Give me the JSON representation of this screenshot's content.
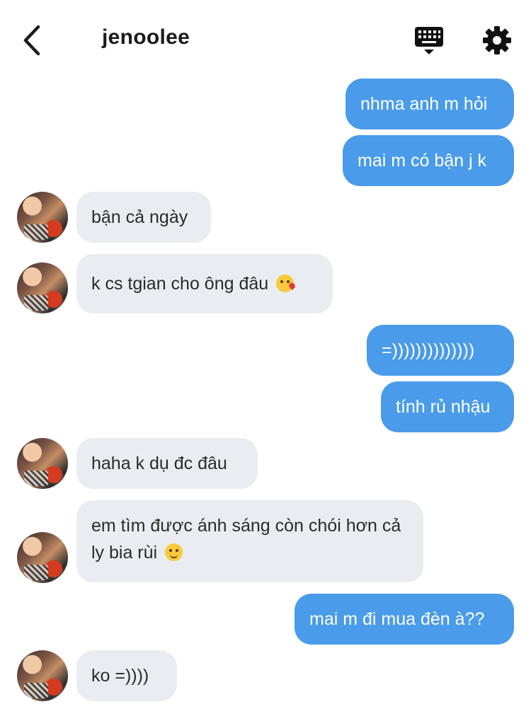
{
  "header": {
    "title": "jenoolee",
    "back_icon": "chevron-left-icon",
    "keyboard_icon": "keyboard-icon",
    "settings_icon": "gear-icon"
  },
  "colors": {
    "sent_bubble": "#4a9bea",
    "received_bubble": "#e9ecf1"
  },
  "messages": [
    {
      "from": "me",
      "text": "nhma anh m hỏi"
    },
    {
      "from": "me",
      "text": "mai m có bận j k"
    },
    {
      "from": "them",
      "text": "bận cả ngày"
    },
    {
      "from": "them",
      "text": "k cs tgian cho ông đâu",
      "emoji": "kissing-face-emoji"
    },
    {
      "from": "me",
      "text": "=))))))))))))))"
    },
    {
      "from": "me",
      "text": "tính rủ nhậu"
    },
    {
      "from": "them",
      "text": "haha k dụ đc đâu"
    },
    {
      "from": "them",
      "text": "em tìm được ánh sáng còn chói hơn cả ly bia rùi",
      "emoji": "smiling-face-emoji"
    },
    {
      "from": "me",
      "text": "mai m đi mua đèn à??"
    },
    {
      "from": "them",
      "text": "ko =))))"
    }
  ]
}
